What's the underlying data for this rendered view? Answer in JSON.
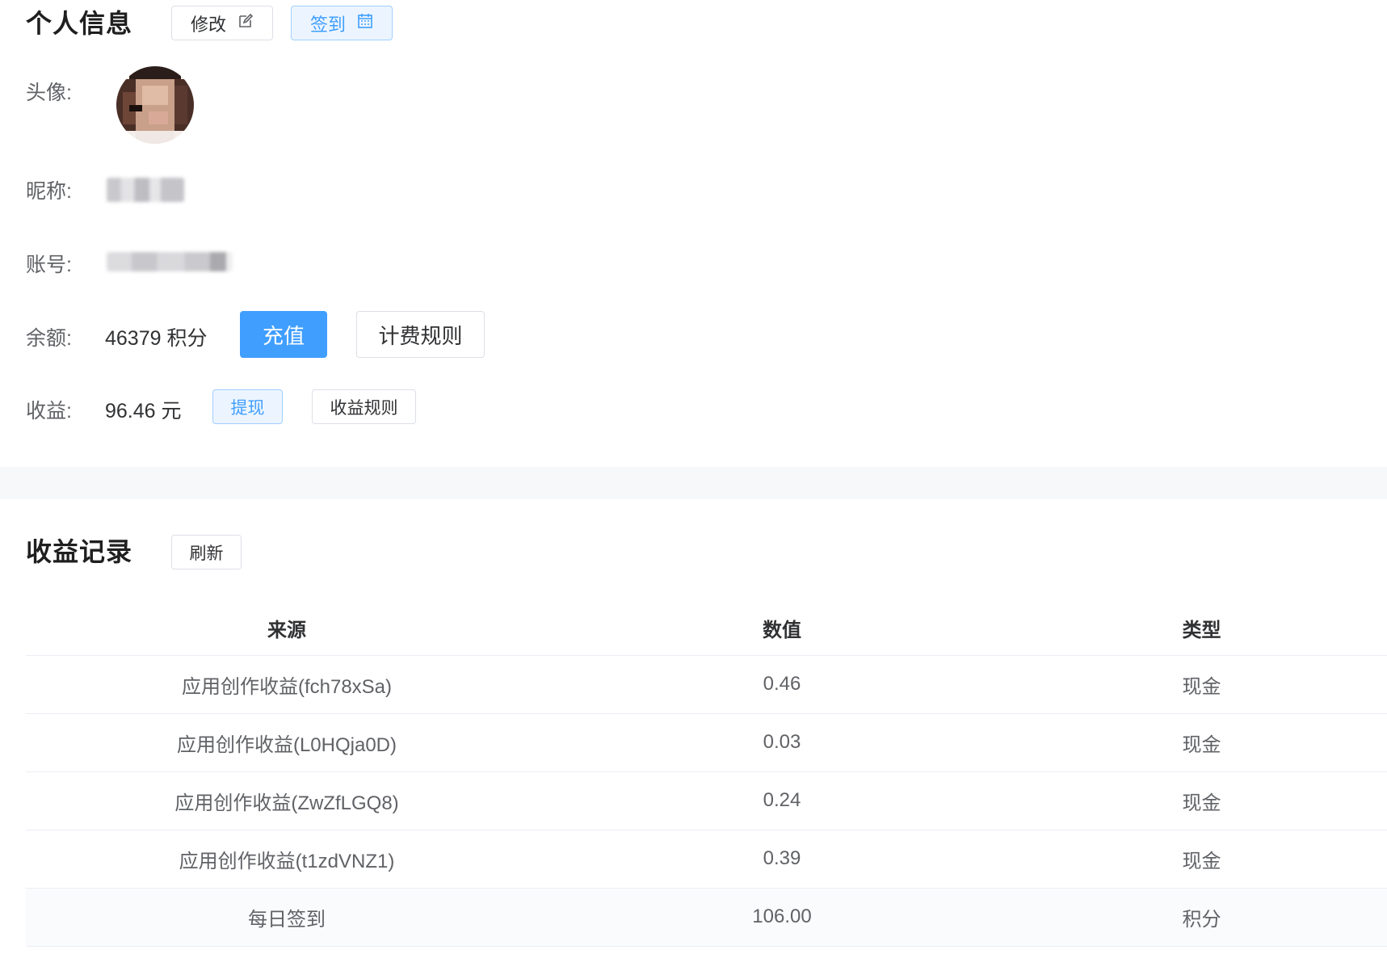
{
  "profile": {
    "title": "个人信息",
    "edit_label": "修改",
    "checkin_label": "签到",
    "avatar_label": "头像:",
    "nickname_label": "昵称:",
    "account_label": "账号:",
    "balance_label": "余额:",
    "balance_value": "46379 积分",
    "recharge_label": "充值",
    "billing_rules_label": "计费规则",
    "earnings_label": "收益:",
    "earnings_value": "96.46 元",
    "withdraw_label": "提现",
    "earnings_rules_label": "收益规则"
  },
  "records": {
    "title": "收益记录",
    "refresh_label": "刷新",
    "columns": [
      "来源",
      "数值",
      "类型"
    ],
    "rows": [
      {
        "source": "应用创作收益(fch78xSa)",
        "value": "0.46",
        "type": "现金"
      },
      {
        "source": "应用创作收益(L0HQja0D)",
        "value": "0.03",
        "type": "现金"
      },
      {
        "source": "应用创作收益(ZwZfLGQ8)",
        "value": "0.24",
        "type": "现金"
      },
      {
        "source": "应用创作收益(t1zdVNZ1)",
        "value": "0.39",
        "type": "现金"
      },
      {
        "source": "每日签到",
        "value": "106.00",
        "type": "积分"
      }
    ]
  },
  "icons": {
    "edit": "edit-icon",
    "checkin": "calendar-icon"
  },
  "colors": {
    "primary": "#409eff",
    "primary_light_bg": "#ecf5ff",
    "border": "#dcdfe6"
  }
}
